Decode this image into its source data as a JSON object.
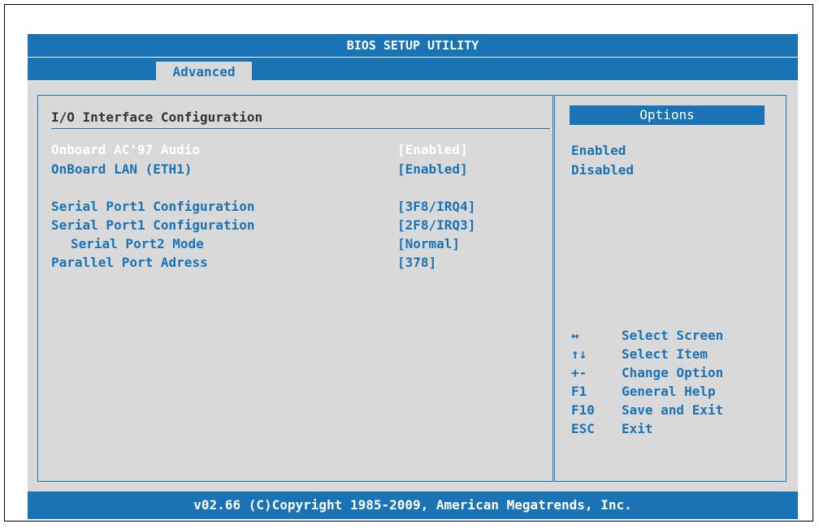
{
  "app_title": "BIOS SETUP UTILITY",
  "tab": {
    "label": "Advanced"
  },
  "section_title": "I/O Interface Configuration",
  "settings": [
    {
      "label": "Onboard AC'97 Audio",
      "value": "[Enabled]",
      "selected": true
    },
    {
      "label": "OnBoard LAN (ETH1)",
      "value": "[Enabled]"
    },
    {
      "label": "Serial Port1 Configuration",
      "value": "[3F8/IRQ4]"
    },
    {
      "label": "Serial Port1 Configuration",
      "value": "[2F8/IRQ3]"
    },
    {
      "label": "Serial Port2 Mode",
      "value": "[Normal]",
      "indented": true
    },
    {
      "label": "Parallel Port Adress",
      "value": "[378]"
    }
  ],
  "options": {
    "header": "Options",
    "items": [
      "Enabled",
      "Disabled"
    ]
  },
  "help": [
    {
      "key": "↔",
      "desc": "Select Screen"
    },
    {
      "key": "↑↓",
      "desc": "Select Item"
    },
    {
      "key": "+-",
      "desc": "Change Option"
    },
    {
      "key": "F1",
      "desc": "General Help"
    },
    {
      "key": "F10",
      "desc": "Save and Exit"
    },
    {
      "key": "ESC",
      "desc": "Exit"
    }
  ],
  "footer": "v02.66 (C)Copyright 1985-2009, American Megatrends, Inc.",
  "colors": {
    "accent": "#1a73b5",
    "panel": "#d9d9d9",
    "selected_text": "#ffffff"
  }
}
